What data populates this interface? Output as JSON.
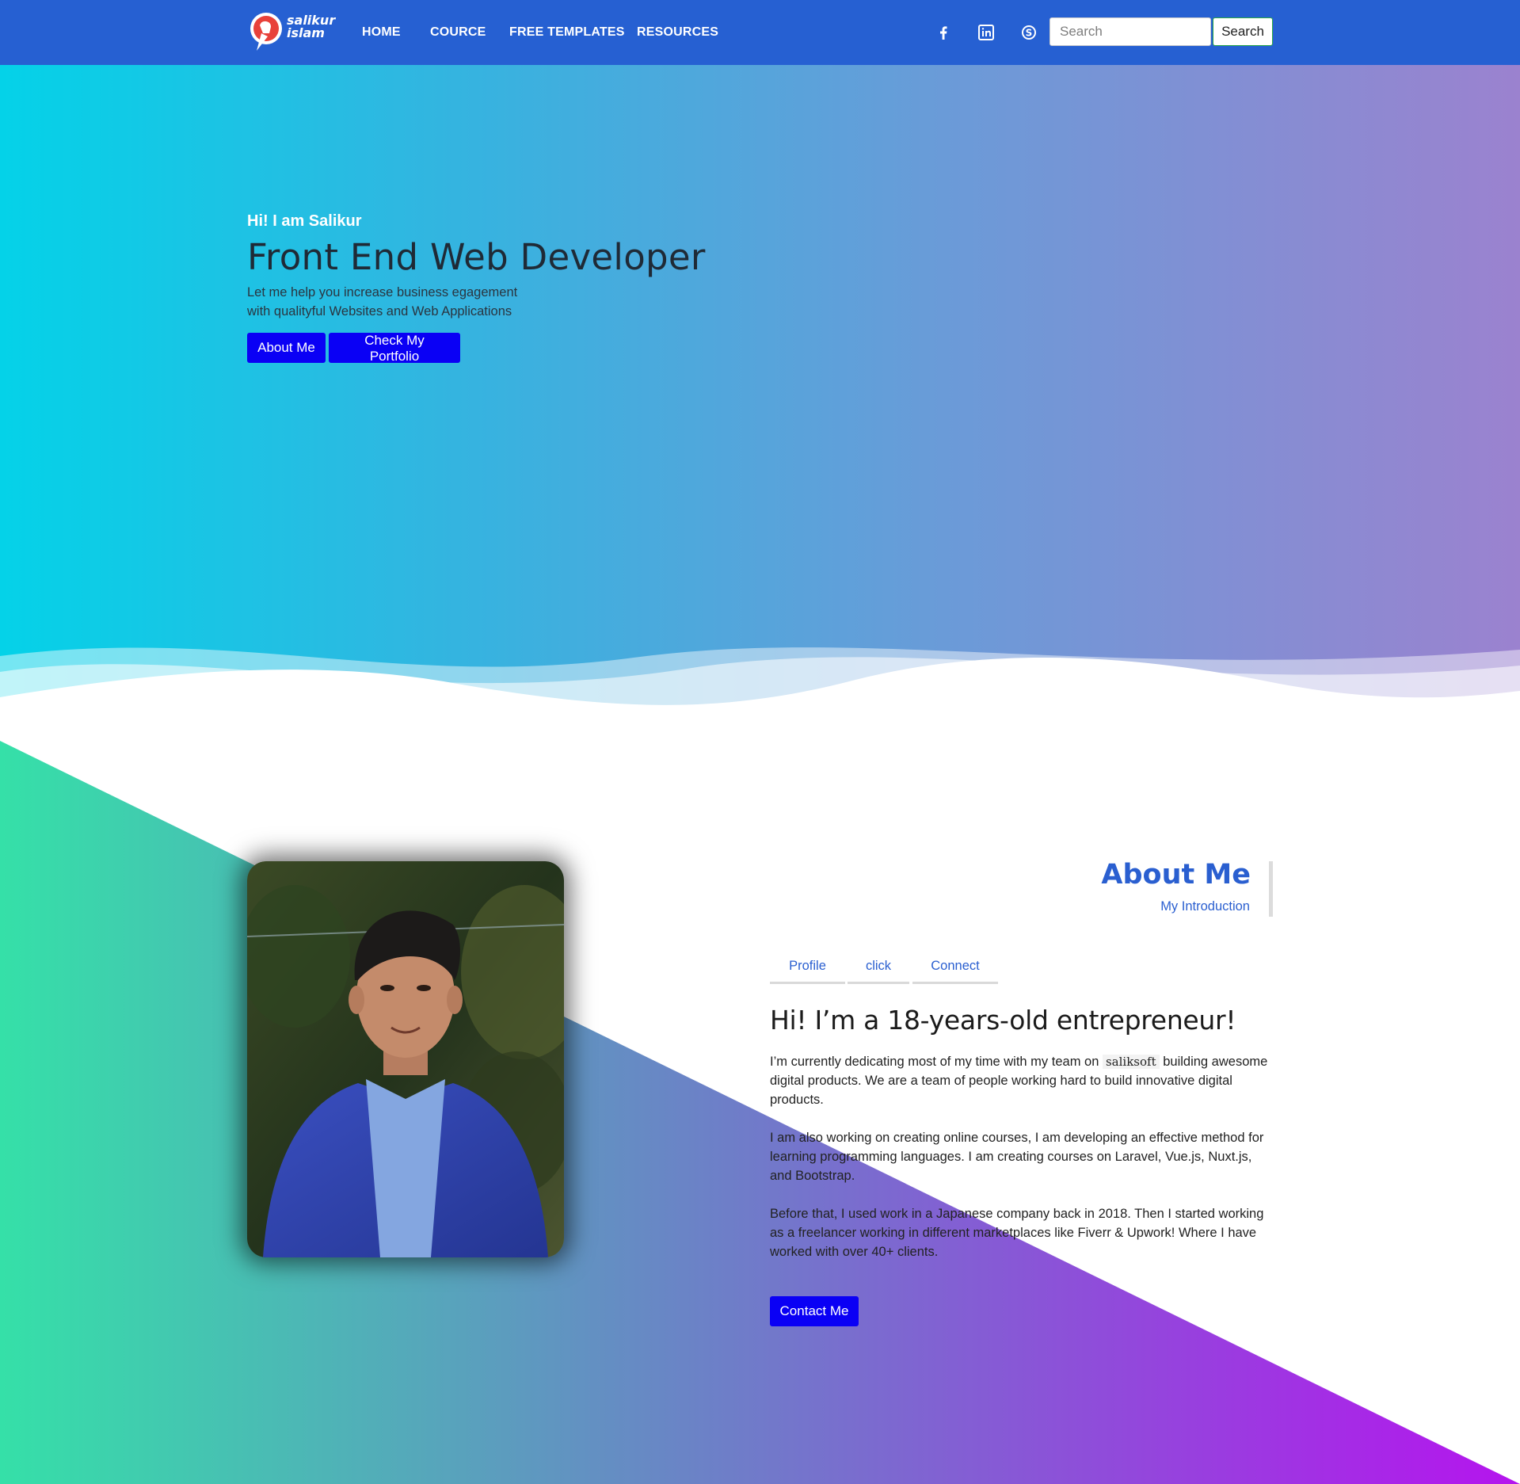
{
  "navbar": {
    "brand": {
      "line1": "salikur",
      "line2": "islam"
    },
    "links": [
      "HOME",
      "COURCE",
      "FREE TEMPLATES",
      "RESOURCES"
    ],
    "social": [
      "facebook-icon",
      "linkedin-icon",
      "skype-icon"
    ],
    "search": {
      "placeholder": "Search",
      "button_label": "Search"
    },
    "color": "#2660d2"
  },
  "hero": {
    "greeting": "Hi! I am Salikur",
    "title": "Front End Web Developer",
    "description_line1": "Let me help you increase business egagement",
    "description_line2": "with qualityful Websites and Web Applications",
    "buttons": [
      "About Me",
      "Check My Portfolio"
    ],
    "gradient": [
      "#04d2e8",
      "#9b82cf"
    ]
  },
  "about": {
    "heading": "About Me",
    "subheading": "My Introduction",
    "tabs": [
      "Profile",
      "click",
      "Connect"
    ],
    "intro_title": "Hi! I’m a 18-years-old entrepreneur!",
    "para1_before": "I’m currently dedicating most of my time with my team on",
    "para1_brand": "saliksoft",
    "para1_after": "building awesome digital products. We are a team of people working hard to build innovative digital products.",
    "para2": "I am also working on creating online courses, I am developing an effective method for learning programming languages. I am creating courses on Laravel, Vue.js, Nuxt.js, and Bootstrap.",
    "para3": "Before that, I used work in a Japanese company back in 2018. Then I started working as a freelancer working in different marketplaces like Fiverr & Upwork! Where I have worked with over 40+ clients.",
    "contact_button": "Contact Me",
    "accent": "#2a5fd0",
    "button_color": "#0a00f5"
  }
}
